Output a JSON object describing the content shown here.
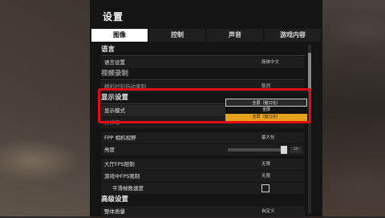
{
  "title": "设置",
  "tabs": [
    "图像",
    "控制",
    "声音",
    "游戏内容"
  ],
  "sections": {
    "language": "语言",
    "video_record": "视频录制",
    "display": "显示设置",
    "advanced": "高级设置"
  },
  "rows": {
    "language_setting": {
      "label": "语言设置",
      "value": "简体中文"
    },
    "record_auto": {
      "label": "精彩时刻自动录制",
      "value": "取消"
    },
    "display_mode": {
      "label": "显示模式"
    },
    "resolution": {
      "label": "分辨率"
    },
    "fpp_fov": {
      "label": "FPP 相机视野",
      "value": "最大化"
    },
    "brightness": {
      "label": "亮度",
      "value": "50"
    },
    "lobby_fps": {
      "label": "大厅FPS限制",
      "value": "无限"
    },
    "ingame_fps": {
      "label": "游戏中FPS限制",
      "value": "无限"
    },
    "smoothing": {
      "label": "平滑帧数速度"
    },
    "overall_quality": {
      "label": "整体质量",
      "value": "自定义"
    }
  },
  "dropdown": {
    "selected": "全屏（窗口化）",
    "options": [
      "全屏",
      "全屏（窗口化）"
    ],
    "active_index": 1
  },
  "colors": {
    "highlight": "#e00d17",
    "active_option": "#e6a21b"
  }
}
